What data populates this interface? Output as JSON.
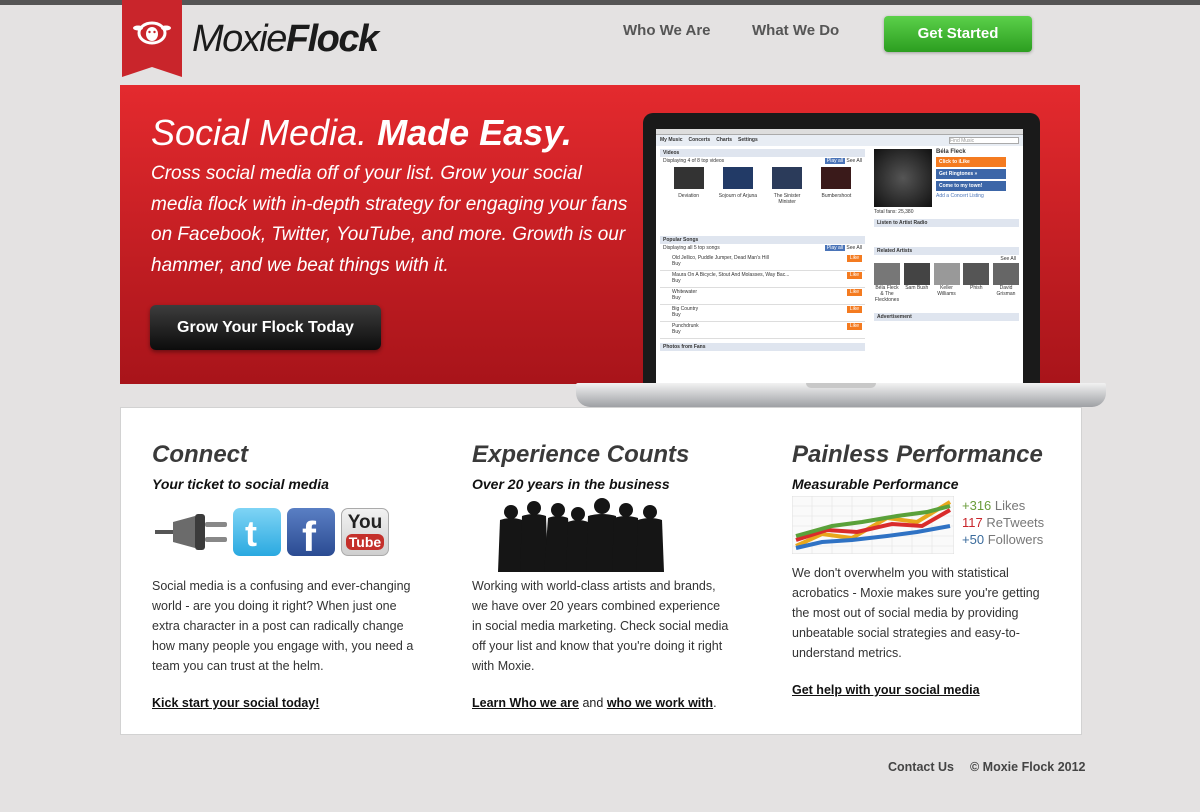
{
  "brand": {
    "name_light": "Moxie",
    "name_bold": "Flock",
    "logo_icon": "sheep-icon",
    "accent": "#c9252b"
  },
  "nav": {
    "who": "Who We Are",
    "what": "What We Do",
    "cta": "Get Started",
    "cta_color": "#3cb52c"
  },
  "hero": {
    "title_light": "Social Media.",
    "title_bold": "Made Easy.",
    "text": "Cross social media off of your list. Grow your social media flock with in-depth strategy for engaging your fans on Facebook, Twitter, YouTube, and more. Growth is our hammer, and we beat things with it.",
    "button": "Grow Your Flock Today"
  },
  "laptop": {
    "tabs": [
      "My Music",
      "Concerts",
      "Charts",
      "Settings"
    ],
    "search_placeholder": "Find Music",
    "videos_head": "Videos",
    "videos_sub": "Displaying 4 of 8 top videos",
    "play_all": "Play all",
    "see_all": "See All",
    "video_titles": [
      "Deviation",
      "Sojourn of Arjuna",
      "The Sinister Minister",
      "Bumbershoot"
    ],
    "songs_head": "Popular Songs",
    "songs_sub": "Displaying all 5 top songs",
    "songs": [
      "Old Jellico, Puddle Jumper, Dead Man's Hill",
      "Maura On A Bicycle, Stout And Molasses, Way Bac...",
      "Whitewater",
      "Big Country",
      "Punchdrunk"
    ],
    "song_action": "Buy",
    "like": "Like",
    "photos_head": "Photos from Fans",
    "artist": "Béla Fleck",
    "click_like": "Click to iLike",
    "get_ringtones": "Get Ringtones »",
    "come_town": "Come to my town!",
    "concert_listing": "Add a Concert Listing",
    "total_fans": "Total fans: 25,380",
    "radio": "Listen to Artist Radio",
    "related": "Related Artists",
    "related_names": [
      "Béla Fleck & The Flecktones",
      "Sam Bush",
      "Keller Williams",
      "Phish",
      "David Grisman"
    ],
    "ad": "Advertisement"
  },
  "columns": [
    {
      "title": "Connect",
      "subtitle": "Your ticket to social media",
      "body": "Social media is a confusing and ever-changing world - are you doing it right? When just one extra character in a post can radically change how many people you engage with, you need a team you can trust at the helm.",
      "link": "Kick start your social today!",
      "icons": [
        "plug-icon",
        "twitter-icon",
        "facebook-icon",
        "youtube-icon"
      ],
      "youtube_top": "You",
      "youtube_bottom": "Tube"
    },
    {
      "title": "Experience Counts",
      "subtitle": "Over 20 years in the business",
      "body": "Working with world-class artists and brands, we have over 20 years combined experience in social media marketing. Check social media off your list and know that you're doing it right with Moxie.",
      "link_a": "Learn Who we are",
      "joiner": "and",
      "link_b": "who we work with",
      "period": "."
    },
    {
      "title": "Painless Performance",
      "subtitle": "Measurable Performance",
      "body": "We don't overwhelm you with statistical acrobatics - Moxie makes sure you're getting the most out of social media by providing unbeatable social strategies and easy-to-understand metrics.",
      "link": "Get help with your social media",
      "stats": [
        {
          "value": "+316",
          "label": "Likes",
          "color": "#6a9c3a"
        },
        {
          "value": "117",
          "label": "ReTweets",
          "color": "#c9252b"
        },
        {
          "value": "+50",
          "label": "Followers",
          "color": "#3a6b9c"
        }
      ]
    }
  ],
  "footer": {
    "contact": "Contact Us",
    "copyright": "© Moxie Flock 2012"
  }
}
